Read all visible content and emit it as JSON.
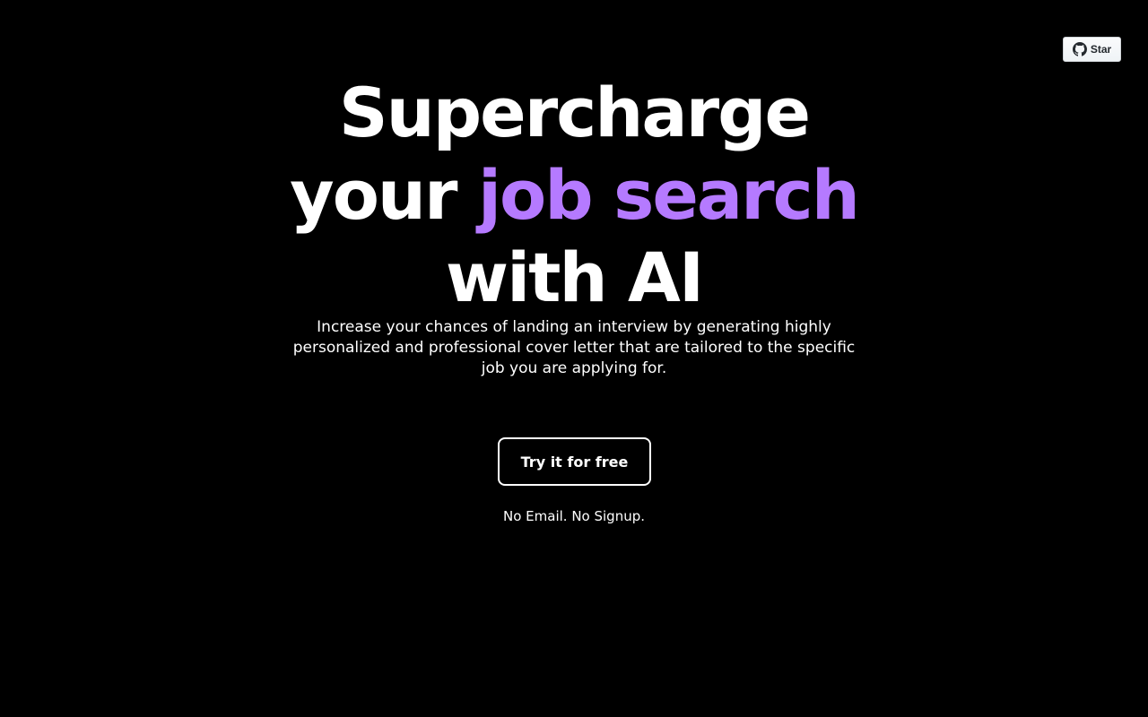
{
  "github": {
    "star_label": "Star",
    "icon": "github-icon"
  },
  "hero": {
    "title_line1": "Supercharge",
    "title_line2_prefix": "your ",
    "title_line2_accent": "job search",
    "title_line3": "with AI",
    "accent_color": "#b57aff",
    "subtitle": "Increase your chances of landing an interview by generating highly personalized and professional cover letter that are tailored to the specific job you are applying for."
  },
  "cta": {
    "button_label": "Try it for free",
    "note": "No Email. No Signup."
  }
}
